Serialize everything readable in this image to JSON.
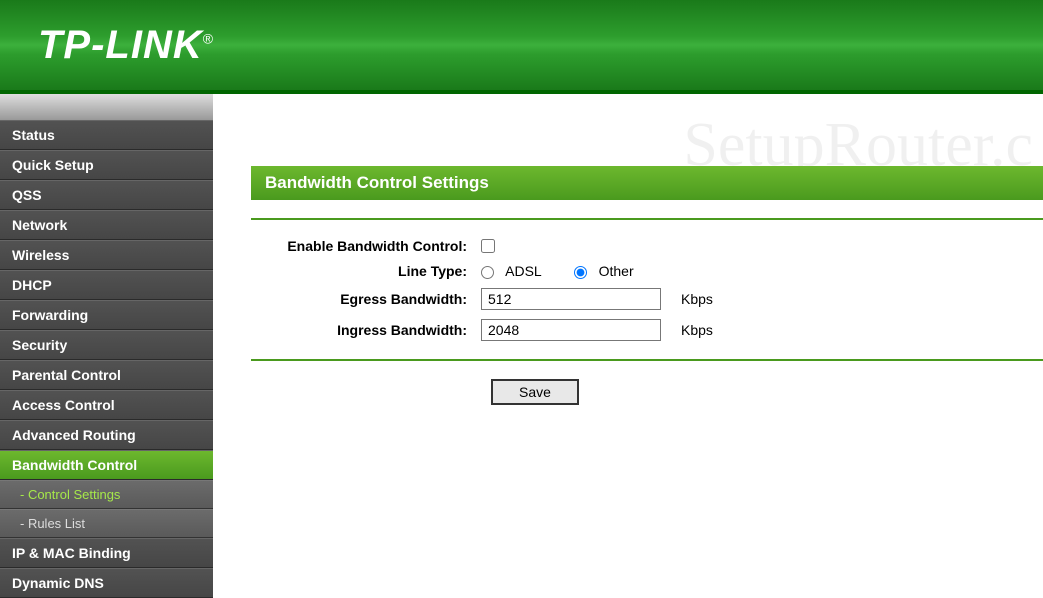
{
  "brand": "TP-LINK",
  "watermark": "SetupRouter.c",
  "sidebar": {
    "items": [
      {
        "label": "Status"
      },
      {
        "label": "Quick Setup"
      },
      {
        "label": "QSS"
      },
      {
        "label": "Network"
      },
      {
        "label": "Wireless"
      },
      {
        "label": "DHCP"
      },
      {
        "label": "Forwarding"
      },
      {
        "label": "Security"
      },
      {
        "label": "Parental Control"
      },
      {
        "label": "Access Control"
      },
      {
        "label": "Advanced Routing"
      },
      {
        "label": "Bandwidth Control"
      },
      {
        "label": "- Control Settings"
      },
      {
        "label": "- Rules List"
      },
      {
        "label": "IP & MAC Binding"
      },
      {
        "label": "Dynamic DNS"
      }
    ]
  },
  "page": {
    "title": "Bandwidth Control Settings"
  },
  "form": {
    "enable_label": "Enable Bandwidth Control:",
    "enable_checked": false,
    "line_type_label": "Line Type:",
    "line_type_options": {
      "adsl": "ADSL",
      "other": "Other"
    },
    "line_type_selected": "other",
    "egress_label": "Egress Bandwidth:",
    "egress_value": "512",
    "ingress_label": "Ingress Bandwidth:",
    "ingress_value": "2048",
    "unit": "Kbps",
    "save_label": "Save"
  }
}
